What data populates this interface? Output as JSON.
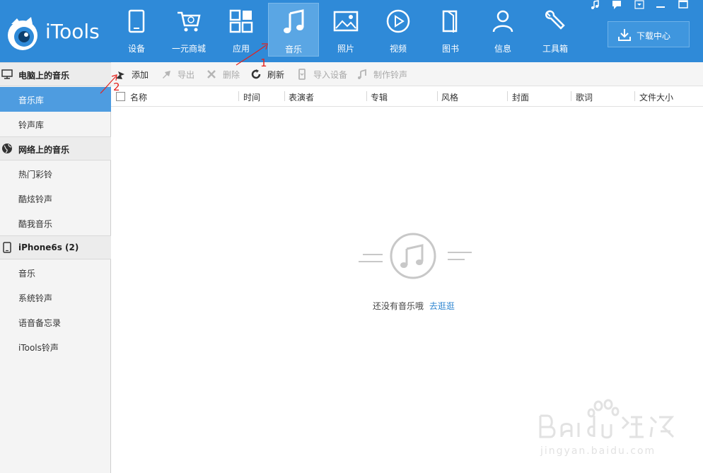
{
  "app": {
    "name": "iTools"
  },
  "nav": {
    "items": [
      {
        "label": "设备",
        "icon": "device-icon"
      },
      {
        "label": "一元商城",
        "icon": "cart-icon"
      },
      {
        "label": "应用",
        "icon": "apps-icon"
      },
      {
        "label": "音乐",
        "icon": "music-icon",
        "active": true
      },
      {
        "label": "照片",
        "icon": "photo-icon"
      },
      {
        "label": "视频",
        "icon": "video-icon"
      },
      {
        "label": "图书",
        "icon": "book-icon"
      },
      {
        "label": "信息",
        "icon": "user-icon"
      },
      {
        "label": "工具箱",
        "icon": "wrench-icon"
      }
    ],
    "download_label": "下载中心"
  },
  "sidebar": {
    "sections": [
      {
        "title": "电脑上的音乐",
        "icon": "monitor-icon",
        "items": [
          "音乐库",
          "铃声库"
        ],
        "active_item": "音乐库"
      },
      {
        "title": "网络上的音乐",
        "icon": "globe-icon",
        "items": [
          "热门彩铃",
          "酷炫铃声",
          "酷我音乐"
        ]
      },
      {
        "title": "iPhone6s (2)",
        "icon": "phone-icon",
        "items": [
          "音乐",
          "系统铃声",
          "语音备忘录",
          "iTools铃声"
        ]
      }
    ]
  },
  "toolbar": {
    "add": "添加",
    "export": "导出",
    "delete": "删除",
    "refresh": "刷新",
    "import_device": "导入设备",
    "make_ringtone": "制作铃声"
  },
  "table": {
    "columns": [
      "名称",
      "时间",
      "表演者",
      "专辑",
      "风格",
      "封面",
      "歌词",
      "文件大小"
    ]
  },
  "empty": {
    "message": "还没有音乐哦",
    "link": "去逛逛"
  },
  "annotations": {
    "marker_1": "1",
    "marker_2": "2"
  },
  "colors": {
    "topbar": "#2f8ad8",
    "active_nav": "#5aa6e4",
    "sidebar_active": "#4e9ce0",
    "link": "#2f86d1"
  }
}
